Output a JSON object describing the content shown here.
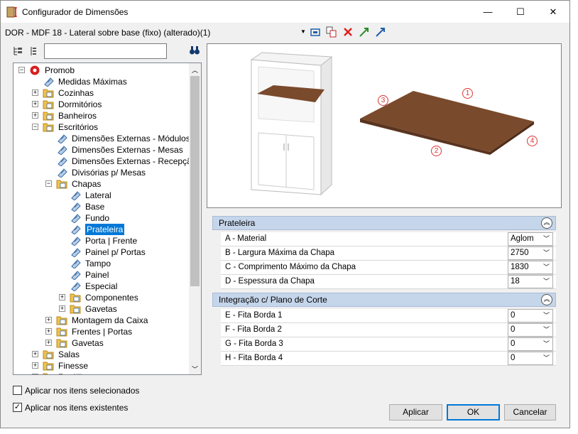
{
  "window": {
    "title": "Configurador de Dimensões",
    "minimize": "—",
    "maximize": "☐",
    "close": "✕"
  },
  "toolbar": {
    "document": "DOR - MDF 18 - Lateral sobre base (fixo) (alterado)(1)",
    "dropdown_arrow": "▼"
  },
  "tree": {
    "nodes": [
      {
        "label": "Promob",
        "expand": "−",
        "icon": "promob-logo-icon"
      },
      {
        "label": "Medidas Máximas",
        "icon": "tag-icon"
      },
      {
        "label": "Cozinhas",
        "expand": "+",
        "icon": "folder-icon"
      },
      {
        "label": "Dormitórios",
        "expand": "+",
        "icon": "folder-icon"
      },
      {
        "label": "Banheiros",
        "expand": "+",
        "icon": "folder-icon"
      },
      {
        "label": "Escritórios",
        "expand": "−",
        "icon": "folder-icon"
      },
      {
        "label": "Dimensões Externas - Módulos",
        "icon": "tag-icon"
      },
      {
        "label": "Dimensões Externas - Mesas",
        "icon": "tag-icon"
      },
      {
        "label": "Dimensões Externas - Recepção",
        "icon": "tag-icon"
      },
      {
        "label": "Divisórias p/ Mesas",
        "icon": "tag-icon"
      },
      {
        "label": "Chapas",
        "expand": "−",
        "icon": "folder-icon"
      },
      {
        "label": "Lateral",
        "icon": "tag-icon"
      },
      {
        "label": "Base",
        "icon": "tag-icon"
      },
      {
        "label": "Fundo",
        "icon": "tag-icon"
      },
      {
        "label": "Prateleira",
        "icon": "tag-icon",
        "selected": true
      },
      {
        "label": "Porta | Frente",
        "icon": "tag-icon"
      },
      {
        "label": "Painel p/ Portas",
        "icon": "tag-icon"
      },
      {
        "label": "Tampo",
        "icon": "tag-icon"
      },
      {
        "label": "Painel",
        "icon": "tag-icon"
      },
      {
        "label": "Especial",
        "icon": "tag-icon"
      },
      {
        "label": "Componentes",
        "expand": "+",
        "icon": "folder-icon"
      },
      {
        "label": "Gavetas",
        "expand": "+",
        "icon": "folder-icon"
      },
      {
        "label": "Montagem da Caixa",
        "expand": "+",
        "icon": "folder-icon"
      },
      {
        "label": "Frentes | Portas",
        "expand": "+",
        "icon": "folder-icon"
      },
      {
        "label": "Gavetas",
        "expand": "+",
        "icon": "folder-icon"
      },
      {
        "label": "Salas",
        "expand": "+",
        "icon": "folder-icon"
      },
      {
        "label": "Finesse",
        "expand": "+",
        "icon": "folder-icon"
      },
      {
        "label": "Rotúlil",
        "expand": "+",
        "icon": "folder-icon"
      }
    ]
  },
  "preview": {
    "markers": [
      "1",
      "2",
      "3",
      "4"
    ],
    "wood_color": "#7a4a2c"
  },
  "groups": [
    {
      "title": "Prateleira",
      "collapse": "︽",
      "rows": [
        {
          "label": "A - Material",
          "value": "Aglom"
        },
        {
          "label": "B - Largura Máxima da Chapa",
          "value": "2750"
        },
        {
          "label": "C - Comprimento Máximo da Chapa",
          "value": "1830"
        },
        {
          "label": "D - Espessura da Chapa",
          "value": "18"
        }
      ]
    },
    {
      "title": "Integração c/ Plano de Corte",
      "collapse": "︽",
      "rows": [
        {
          "label": "E - Fita Borda 1",
          "value": "0"
        },
        {
          "label": "F - Fita Borda 2",
          "value": "0"
        },
        {
          "label": "G - Fita Borda 3",
          "value": "0"
        },
        {
          "label": "H - Fita Borda 4",
          "value": "0"
        }
      ]
    }
  ],
  "options": {
    "apply_selected": "Aplicar nos itens selecionados",
    "apply_selected_checked": false,
    "apply_existing": "Aplicar nos itens existentes",
    "apply_existing_checked": true,
    "check": "✓"
  },
  "buttons": {
    "apply": "Aplicar",
    "ok": "OK",
    "cancel": "Cancelar"
  },
  "colors": {
    "accent": "#0078d7",
    "group_header": "#c5d5ea",
    "close_red": "#e81123"
  }
}
